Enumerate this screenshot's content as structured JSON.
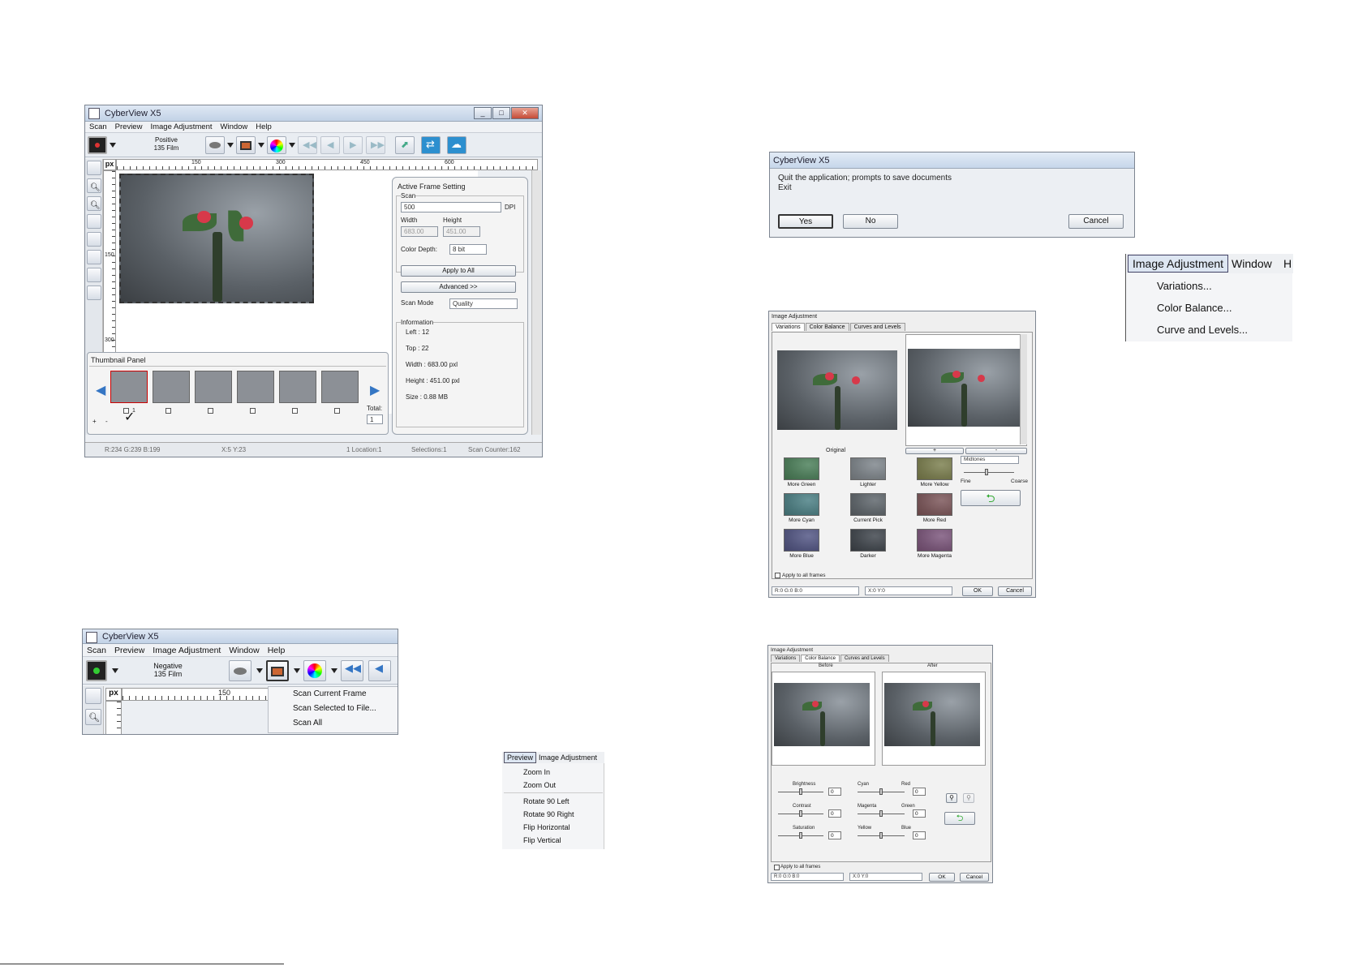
{
  "main_window": {
    "title": "CyberView X5",
    "menu": [
      "Scan",
      "Preview",
      "Image Adjustment",
      "Window",
      "Help"
    ],
    "film_type": {
      "line1": "Positive",
      "line2": "135 Film"
    },
    "ruler_unit": "px",
    "ruler_ticks_h": [
      "150",
      "300",
      "450",
      "600"
    ],
    "ruler_ticks_v": [
      "150",
      "300"
    ],
    "active_frame": {
      "title": "Active Frame Setting",
      "scan_group": "Scan",
      "dpi_value": "500",
      "dpi_unit": "DPI",
      "width_label": "Width",
      "height_label": "Height",
      "width_value": "683.00",
      "height_value": "451.00",
      "color_depth_label": "Color Depth:",
      "color_depth_value": "8 bit",
      "apply_all": "Apply to All",
      "advanced": "Advanced >>",
      "scan_mode_label": "Scan Mode",
      "scan_mode_value": "Quality",
      "info_group": "Information",
      "info": [
        "Left : 12",
        "Top : 22",
        "Width : 683.00 pxl",
        "Height : 451.00 pxl",
        "Size : 0.88 MB"
      ]
    },
    "thumbnail": {
      "title": "Thumbnail Panel",
      "frame_no": "1",
      "total_label": "Total:",
      "total_value": "1",
      "plus": "+",
      "minus": "-"
    },
    "status": [
      "R:234 G:239 B:199",
      "X:5 Y:23",
      "1 Location:1",
      "Selections:1",
      "Scan Counter:162"
    ]
  },
  "scan_window": {
    "title": "CyberView X5",
    "menu": [
      "Scan",
      "Preview",
      "Image Adjustment",
      "Window",
      "Help"
    ],
    "film_type": {
      "line1": "Negative",
      "line2": "135 Film"
    },
    "ruler_unit": "px",
    "ruler_tick": "150",
    "scan_menu": [
      "Scan Current Frame",
      "Scan Selected to File...",
      "Scan All"
    ]
  },
  "preview_menu": {
    "bar": [
      "Preview",
      "Image Adjustment"
    ],
    "items": [
      "Zoom In",
      "Zoom Out",
      "Rotate 90 Left",
      "Rotate 90 Right",
      "Flip Horizontal",
      "Flip Vertical"
    ]
  },
  "exit_dialog": {
    "title": "CyberView X5",
    "message1": "Quit the application; prompts to save documents",
    "message2": "Exit",
    "yes": "Yes",
    "no": "No",
    "cancel": "Cancel"
  },
  "image_adj_menu": {
    "bar": [
      "Image Adjustment",
      "Window",
      "H"
    ],
    "items": [
      "Variations...",
      "Color Balance...",
      "Curve and Levels..."
    ]
  },
  "variations_window": {
    "title": "Image Adjustment",
    "tabs": [
      "Variations",
      "Color Balance",
      "Curves and Levels"
    ],
    "original_label": "Original",
    "plus": "+",
    "minus": "-",
    "range_value": "Midtones",
    "fine": "Fine",
    "coarse": "Coarse",
    "cells": [
      {
        "label": "More Green",
        "tint": "#3f8a4a"
      },
      {
        "label": "Lighter",
        "tint": "#8e9498"
      },
      {
        "label": "More Yellow",
        "tint": "#8a8a3a"
      },
      {
        "label": "More Cyan",
        "tint": "#3f8a8c"
      },
      {
        "label": "Current Pick",
        "tint": "#5c6266"
      },
      {
        "label": "More Red",
        "tint": "#8a4a4a"
      },
      {
        "label": "More Blue",
        "tint": "#4a4a8c"
      },
      {
        "label": "Darker",
        "tint": "#2e3236"
      },
      {
        "label": "More Magenta",
        "tint": "#8a4a80"
      }
    ],
    "apply_all": "Apply to all frames",
    "rgb": "R:0 G:0 B:0",
    "xy": "X:0 Y:0",
    "ok": "OK",
    "cancel": "Cancel"
  },
  "balance_window": {
    "title": "Image Adjustment",
    "tabs": [
      "Variations",
      "Color Balance",
      "Curves and Levels"
    ],
    "before": "Before",
    "after": "After",
    "sliders": [
      {
        "label": "Brightness",
        "value": "0"
      },
      {
        "label": "Contrast",
        "value": "0"
      },
      {
        "label": "Saturation",
        "value": "0"
      }
    ],
    "color_sliders": [
      {
        "left": "Cyan",
        "right": "Red",
        "value": "0"
      },
      {
        "left": "Magenta",
        "right": "Green",
        "value": "0"
      },
      {
        "left": "Yellow",
        "right": "Blue",
        "value": "0"
      }
    ],
    "apply_all": "Apply to all frames",
    "rgb": "R:0 G:0 B:0",
    "xy": "X:0 Y:0",
    "ok": "OK",
    "cancel": "Cancel"
  }
}
